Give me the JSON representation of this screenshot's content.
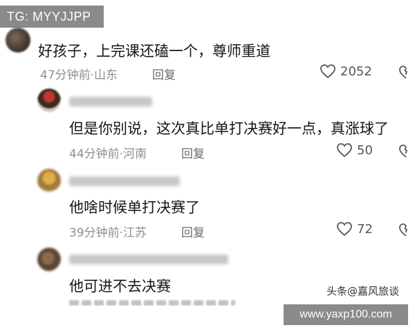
{
  "watermarks": {
    "telegram": "TG: MYYJJPP",
    "site": "www.yaxp100.com",
    "platform": "头条@嘉风旅谈"
  },
  "comments": [
    {
      "text": "好孩子，上完课还磕一个，尊师重道",
      "time": "47分钟前",
      "location": "山东",
      "reply_label": "回复",
      "likes": "2052"
    },
    {
      "text": "但是你别说，这次真比单打决赛好一点，真涨球了",
      "time": "44分钟前",
      "location": "河南",
      "reply_label": "回复",
      "likes": "50"
    },
    {
      "text": "他啥时候单打决赛了",
      "time": "39分钟前",
      "location": "江苏",
      "reply_label": "回复",
      "likes": "72"
    },
    {
      "text": "他可进不去决赛"
    }
  ],
  "icons": {
    "like": "heart-outline-icon",
    "dislike": "broken-heart-icon"
  },
  "colors": {
    "text": "#161616",
    "meta": "#8e8e8e",
    "badge_bg": "#8a8a8a"
  }
}
